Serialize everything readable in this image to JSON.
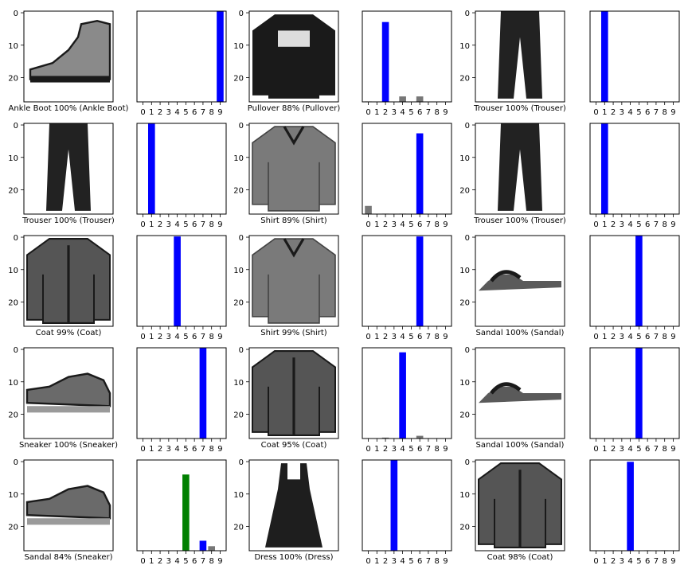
{
  "chart_data": {
    "type": "image-grid-with-bar-charts",
    "layout": {
      "rows": 5,
      "cols": 3
    },
    "colors": {
      "correct": "#0000ff",
      "incorrect": "#008000",
      "other": "#777777",
      "axis": "#000000"
    },
    "y_ticks": [
      "0",
      "10",
      "20"
    ],
    "x_ticks": [
      "0",
      "1",
      "2",
      "3",
      "4",
      "5",
      "6",
      "7",
      "8",
      "9"
    ],
    "bar_ylim": [
      0,
      1
    ],
    "panels": [
      {
        "label": "Ankle Boot 100% (Ankle Boot)",
        "image_icon": "ankle-boot-image",
        "predicted": 9,
        "true": 9,
        "probabilities": [
          0,
          0,
          0,
          0,
          0,
          0,
          0,
          0.002,
          0.003,
          1.0
        ]
      },
      {
        "label": "Pullover 88% (Pullover)",
        "image_icon": "pullover-image",
        "predicted": 2,
        "true": 2,
        "probabilities": [
          0.005,
          0,
          0.88,
          0,
          0.06,
          0,
          0.06,
          0,
          0,
          0
        ]
      },
      {
        "label": "Trouser 100% (Trouser)",
        "image_icon": "trouser-image",
        "predicted": 1,
        "true": 1,
        "probabilities": [
          0,
          1.0,
          0,
          0,
          0,
          0,
          0,
          0,
          0,
          0
        ]
      },
      {
        "label": "Trouser 100% (Trouser)",
        "image_icon": "trouser-image",
        "predicted": 1,
        "true": 1,
        "probabilities": [
          0,
          1.0,
          0,
          0,
          0,
          0,
          0,
          0,
          0,
          0
        ]
      },
      {
        "label": "Shirt 89% (Shirt)",
        "image_icon": "shirt-image",
        "predicted": 6,
        "true": 6,
        "probabilities": [
          0.09,
          0,
          0.005,
          0,
          0.005,
          0,
          0.89,
          0,
          0,
          0
        ]
      },
      {
        "label": "Trouser 100% (Trouser)",
        "image_icon": "trouser-image",
        "predicted": 1,
        "true": 1,
        "probabilities": [
          0,
          1.0,
          0,
          0,
          0,
          0,
          0,
          0,
          0,
          0
        ]
      },
      {
        "label": "Coat 99% (Coat)",
        "image_icon": "coat-image",
        "predicted": 4,
        "true": 4,
        "probabilities": [
          0,
          0,
          0,
          0,
          0.99,
          0,
          0.005,
          0,
          0,
          0
        ]
      },
      {
        "label": "Shirt 99% (Shirt)",
        "image_icon": "shirt-image",
        "predicted": 6,
        "true": 6,
        "probabilities": [
          0,
          0,
          0,
          0,
          0.005,
          0,
          0.99,
          0,
          0,
          0
        ]
      },
      {
        "label": "Sandal 100% (Sandal)",
        "image_icon": "sandal-image",
        "predicted": 5,
        "true": 5,
        "probabilities": [
          0,
          0,
          0,
          0,
          0,
          1.0,
          0,
          0,
          0,
          0
        ]
      },
      {
        "label": "Sneaker 100% (Sneaker)",
        "image_icon": "sneaker-image",
        "predicted": 7,
        "true": 7,
        "probabilities": [
          0,
          0,
          0,
          0,
          0,
          0,
          0,
          1.0,
          0,
          0
        ]
      },
      {
        "label": "Coat 95% (Coat)",
        "image_icon": "coat-image",
        "predicted": 4,
        "true": 4,
        "probabilities": [
          0,
          0,
          0.01,
          0,
          0.95,
          0,
          0.03,
          0,
          0,
          0
        ]
      },
      {
        "label": "Sandal 100% (Sandal)",
        "image_icon": "sandal-image",
        "predicted": 5,
        "true": 5,
        "probabilities": [
          0,
          0,
          0,
          0,
          0,
          1.0,
          0,
          0,
          0,
          0
        ]
      },
      {
        "label": "Sandal 84% (Sneaker)",
        "image_icon": "sneaker-image",
        "predicted": 5,
        "true": 7,
        "probabilities": [
          0,
          0,
          0,
          0,
          0,
          0.84,
          0,
          0.11,
          0.05,
          0
        ]
      },
      {
        "label": "Dress 100% (Dress)",
        "image_icon": "dress-image",
        "predicted": 3,
        "true": 3,
        "probabilities": [
          0,
          0,
          0,
          1.0,
          0,
          0,
          0,
          0,
          0,
          0
        ]
      },
      {
        "label": "Coat 98% (Coat)",
        "image_icon": "coat-image",
        "predicted": 4,
        "true": 4,
        "probabilities": [
          0,
          0,
          0.005,
          0,
          0.98,
          0,
          0.005,
          0,
          0.005,
          0
        ]
      }
    ]
  }
}
